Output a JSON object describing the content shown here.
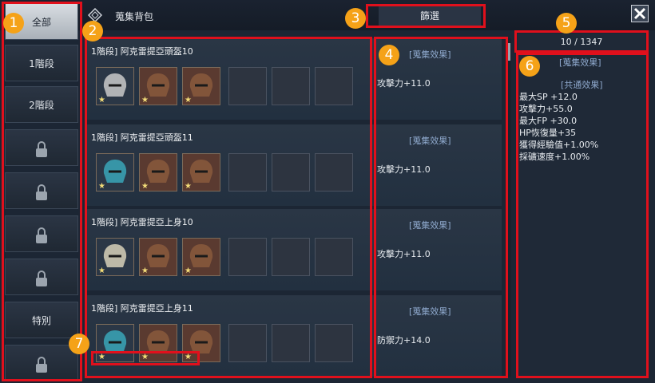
{
  "window": {
    "title": "蒐集背包",
    "filter_label": "篩選",
    "close_label": "×"
  },
  "sidebar": {
    "items": [
      {
        "label": "全部",
        "locked": false,
        "active": true
      },
      {
        "label": "1階段",
        "locked": false
      },
      {
        "label": "2階段",
        "locked": false
      },
      {
        "label": "",
        "locked": true
      },
      {
        "label": "",
        "locked": true
      },
      {
        "label": "",
        "locked": true
      },
      {
        "label": "",
        "locked": true
      },
      {
        "label": "特別",
        "locked": false
      },
      {
        "label": "",
        "locked": true
      }
    ]
  },
  "collection_count": "10 / 1347",
  "entries": [
    {
      "title": "1階段] 阿克雷提亞頭盔10",
      "effect_header": "[蒐集效果]",
      "effect_value": "攻擊力+11.0",
      "item_slots": 3,
      "empty_slots": 3
    },
    {
      "title": "1階段] 阿克雷提亞頭盔11",
      "effect_header": "[蒐集效果]",
      "effect_value": "攻擊力+11.0",
      "item_slots": 3,
      "empty_slots": 3
    },
    {
      "title": "1階段] 阿克雷提亞上身10",
      "effect_header": "[蒐集效果]",
      "effect_value": "攻擊力+11.0",
      "item_slots": 3,
      "empty_slots": 3
    },
    {
      "title": "1階段] 阿克雷提亞上身11",
      "effect_header": "[蒐集效果]",
      "effect_value": "防禦力+14.0",
      "item_slots": 3,
      "empty_slots": 3
    }
  ],
  "star_glyph": "★",
  "summary": {
    "header": "[蒐集效果]",
    "common_header": "[共通效果]",
    "stats": [
      "最大SP +12.0",
      "攻擊力+55.0",
      "最大FP +30.0",
      "HP恢復量+35",
      "獲得經驗值+1.00%",
      "採礦速度+1.00%"
    ]
  },
  "badges": [
    "1",
    "2",
    "3",
    "4",
    "5",
    "6",
    "7"
  ],
  "colors": {
    "highlight": "#e0101c",
    "badge": "#f5a218",
    "star": "#f3dc78",
    "effect_header": "#8ea8cc"
  }
}
